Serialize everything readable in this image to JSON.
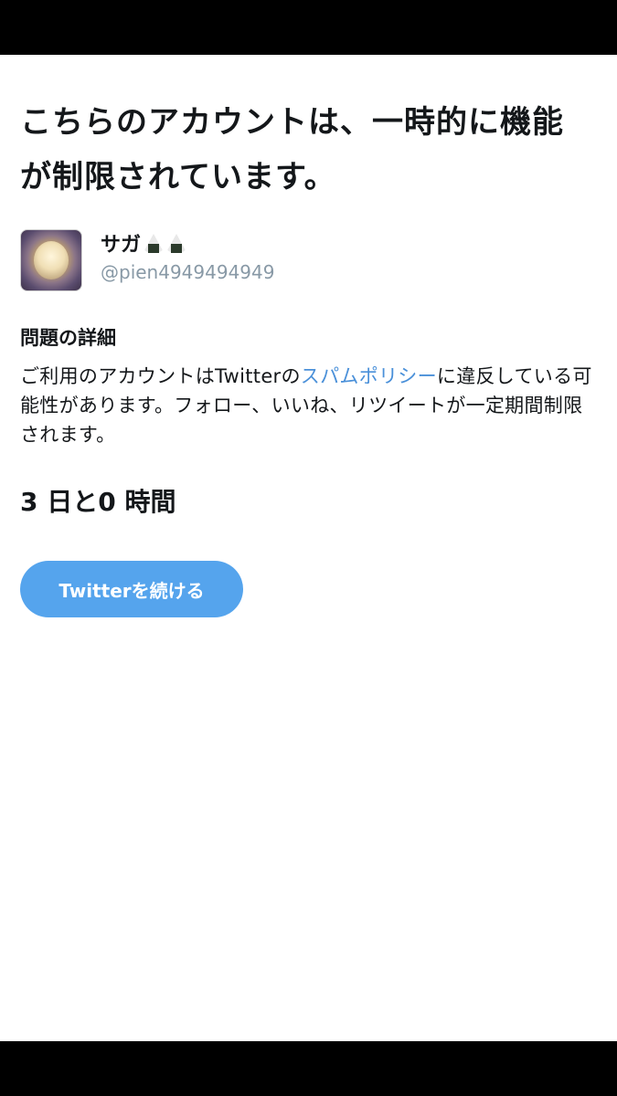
{
  "header": {
    "title": "こちらのアカウントは、一時的に機能が制限されています。"
  },
  "account": {
    "display_name": "サガ",
    "name_emoji": [
      "onigiri-icon",
      "onigiri-icon"
    ],
    "handle": "@pien4949494949"
  },
  "problem": {
    "heading": "問題の詳細",
    "text_before_link": "ご利用のアカウントはTwitterの",
    "link_text": "スパムポリシー",
    "text_after_link": "に違反している可能性があります。フォロー、いいね、リツイートが一定期間制限されます。"
  },
  "countdown": {
    "text": "3 日と0 時間"
  },
  "actions": {
    "continue_label": "Twitterを続ける"
  },
  "colors": {
    "link": "#4a90d9",
    "button": "#55a4ed",
    "handle": "#8899a6",
    "text": "#14171a"
  }
}
